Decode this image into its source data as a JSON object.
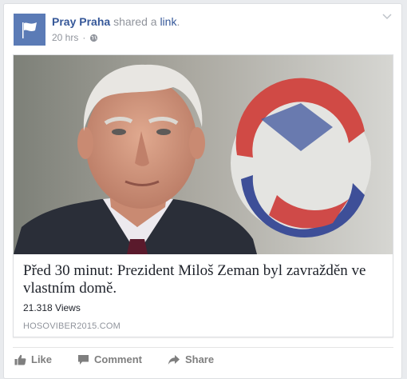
{
  "post": {
    "page_name": "Pray Praha",
    "shared_text": "shared a",
    "link_word": "link",
    "period": ".",
    "time": "20 hrs",
    "dot": "·"
  },
  "link": {
    "headline": "Před 30 minut: Prezident Miloš Zeman byl zavražděn ve vlastním domě.",
    "views": "21.318 Views",
    "domain": "HOSOVIBER2015.COM"
  },
  "actions": [
    {
      "label": "Like",
      "icon": "thumbs-up-icon"
    },
    {
      "label": "Comment",
      "icon": "comment-icon"
    },
    {
      "label": "Share",
      "icon": "share-arrow-icon"
    }
  ],
  "colors": {
    "link_blue": "#365899",
    "meta_gray": "#90949c",
    "avatar_blue": "#5b7bb6",
    "action_gray": "#7f7f7f"
  }
}
